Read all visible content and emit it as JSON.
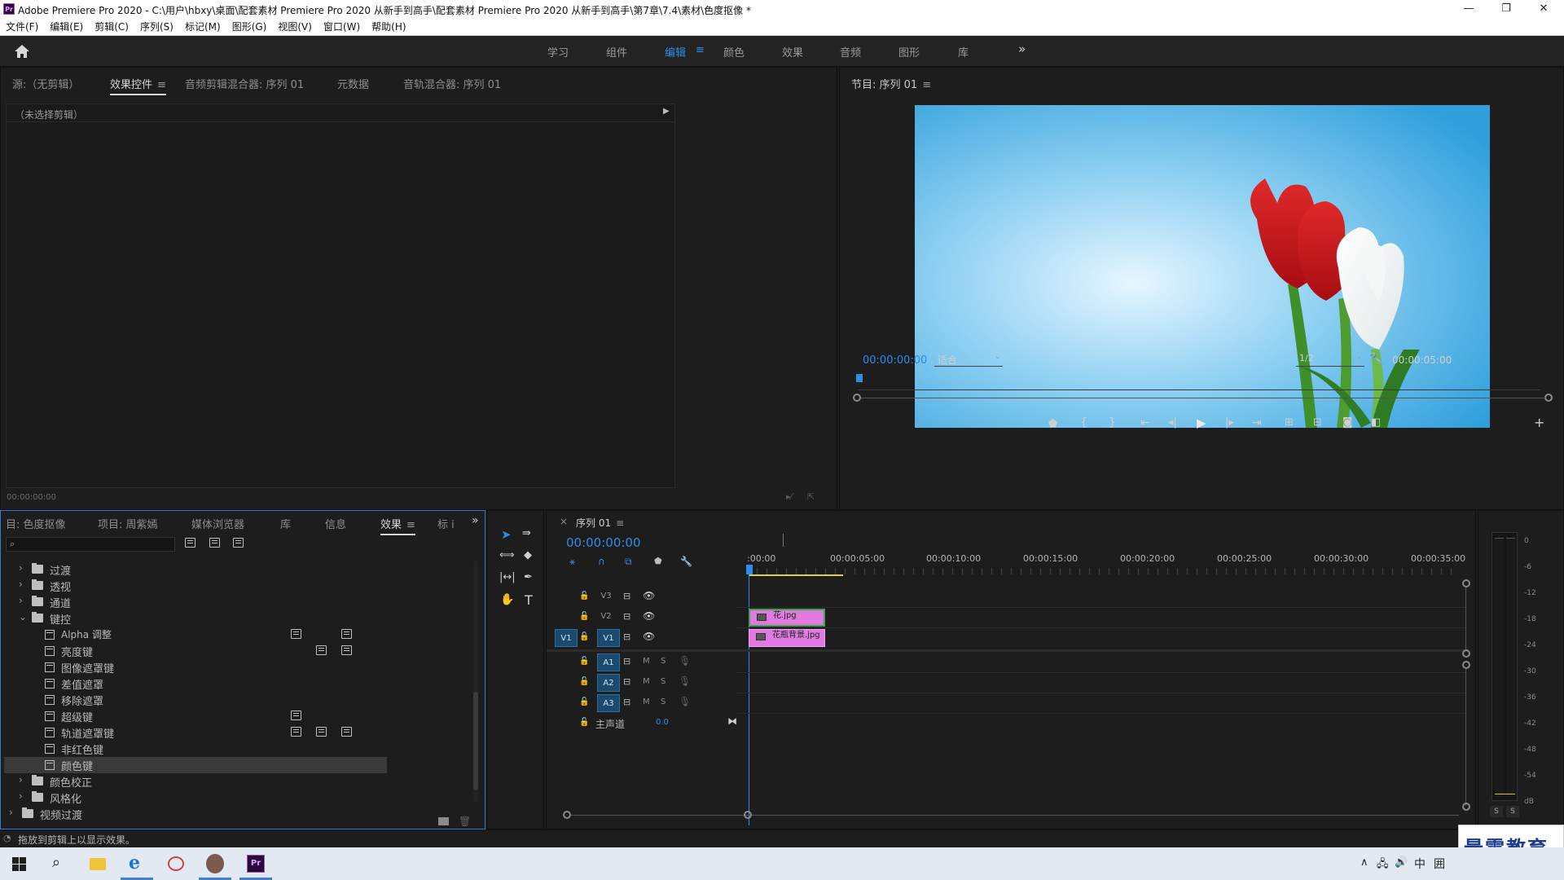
{
  "window": {
    "app_badge": "Pr",
    "title": "Adobe Premiere Pro 2020 - C:\\用户\\hbxy\\桌面\\配套素材 Premiere Pro 2020 从新手到高手\\配套素材 Premiere Pro 2020 从新手到高手\\第7章\\7.4\\素材\\色度抠像 *",
    "controls": [
      "—",
      "❐",
      "✕"
    ]
  },
  "menu": [
    "文件(F)",
    "编辑(E)",
    "剪辑(C)",
    "序列(S)",
    "标记(M)",
    "图形(G)",
    "视图(V)",
    "窗口(W)",
    "帮助(H)"
  ],
  "workspaces": {
    "tabs": [
      "学习",
      "组件",
      "编辑",
      "颜色",
      "效果",
      "音频",
      "图形",
      "库"
    ],
    "active": "编辑",
    "more": "»"
  },
  "source_panel": {
    "tabs": [
      "源:（无剪辑）",
      "效果控件",
      "音频剪辑混合器: 序列 01",
      "元数据",
      "音轨混合器: 序列 01"
    ],
    "active_tab": "效果控件",
    "no_clip": "（未选择剪辑）",
    "timecode": "00:00:00:00"
  },
  "program_monitor": {
    "title": "节目: 序列 01",
    "timecode": "00:00:00:00",
    "fit": "适合",
    "resolution": "1/2",
    "duration": "00:00:05:00"
  },
  "project_panel": {
    "tabs": [
      "目: 色度抠像",
      "项目: 周紫嫣",
      "媒体浏览器",
      "库",
      "信息",
      "效果",
      "标 i"
    ],
    "active_tab": "效果",
    "search_placeholder": "",
    "items": [
      {
        "label": "过渡",
        "kind": "folder",
        "level": 1,
        "expanded": false
      },
      {
        "label": "透视",
        "kind": "folder",
        "level": 1,
        "expanded": false
      },
      {
        "label": "通道",
        "kind": "folder",
        "level": 1,
        "expanded": false
      },
      {
        "label": "键控",
        "kind": "folder",
        "level": 1,
        "expanded": true
      },
      {
        "label": "Alpha 调整",
        "kind": "effect",
        "level": 2,
        "badges": [
          1,
          3
        ]
      },
      {
        "label": "亮度键",
        "kind": "effect",
        "level": 2,
        "badges": [
          2,
          3
        ]
      },
      {
        "label": "图像遮罩键",
        "kind": "effect",
        "level": 2,
        "badges": []
      },
      {
        "label": "差值遮罩",
        "kind": "effect",
        "level": 2,
        "badges": []
      },
      {
        "label": "移除遮罩",
        "kind": "effect",
        "level": 2,
        "badges": []
      },
      {
        "label": "超级键",
        "kind": "effect",
        "level": 2,
        "badges": [
          1
        ]
      },
      {
        "label": "轨道遮罩键",
        "kind": "effect",
        "level": 2,
        "badges": [
          1,
          2,
          3
        ]
      },
      {
        "label": "非红色键",
        "kind": "effect",
        "level": 2,
        "badges": []
      },
      {
        "label": "颜色键",
        "kind": "effect",
        "level": 2,
        "badges": [],
        "selected": true
      },
      {
        "label": "颜色校正",
        "kind": "folder",
        "level": 1,
        "expanded": false
      },
      {
        "label": "风格化",
        "kind": "folder",
        "level": 1,
        "expanded": false
      },
      {
        "label": "视频过渡",
        "kind": "folder",
        "level": 0,
        "expanded": false
      }
    ]
  },
  "timeline": {
    "title": "序列 01",
    "timecode": "00:00:00:00",
    "ruler": [
      ":00:00",
      "00:00:05:00",
      "00:00:10:00",
      "00:00:15:00",
      "00:00:20:00",
      "00:00:25:00",
      "00:00:30:00",
      "00:00:35:00"
    ],
    "video_tracks": [
      {
        "name": "V3",
        "source": ""
      },
      {
        "name": "V2",
        "source": ""
      },
      {
        "name": "V1",
        "source": "V1"
      }
    ],
    "audio_tracks": [
      {
        "name": "A1",
        "source": "A1",
        "m": "M",
        "s": "S"
      },
      {
        "name": "A2",
        "source": "A2",
        "m": "M",
        "s": "S"
      },
      {
        "name": "A3",
        "source": "A3",
        "m": "M",
        "s": "S"
      }
    ],
    "master": {
      "label": "主声道",
      "value": "0.0"
    },
    "clips": [
      {
        "name": "花.jpg",
        "track": "V2"
      },
      {
        "name": "花瓶背景.jpg",
        "track": "V1"
      }
    ]
  },
  "audio_meter": {
    "ticks": [
      "0",
      "-6",
      "-12",
      "-18",
      "-24",
      "-30",
      "-36",
      "-42",
      "-48",
      "-54",
      "dB"
    ],
    "solo": [
      "S",
      "S"
    ]
  },
  "status": {
    "message": "拖放到剪辑上以显示效果。"
  },
  "watermark": "最需教育",
  "taskbar": {
    "tray_ime": "中",
    "tray_grid": "囲"
  },
  "colors": {
    "accent_blue": "#2d8ceb",
    "clip_pink": "#e07ae0",
    "track_target": "#1b4a6e"
  }
}
